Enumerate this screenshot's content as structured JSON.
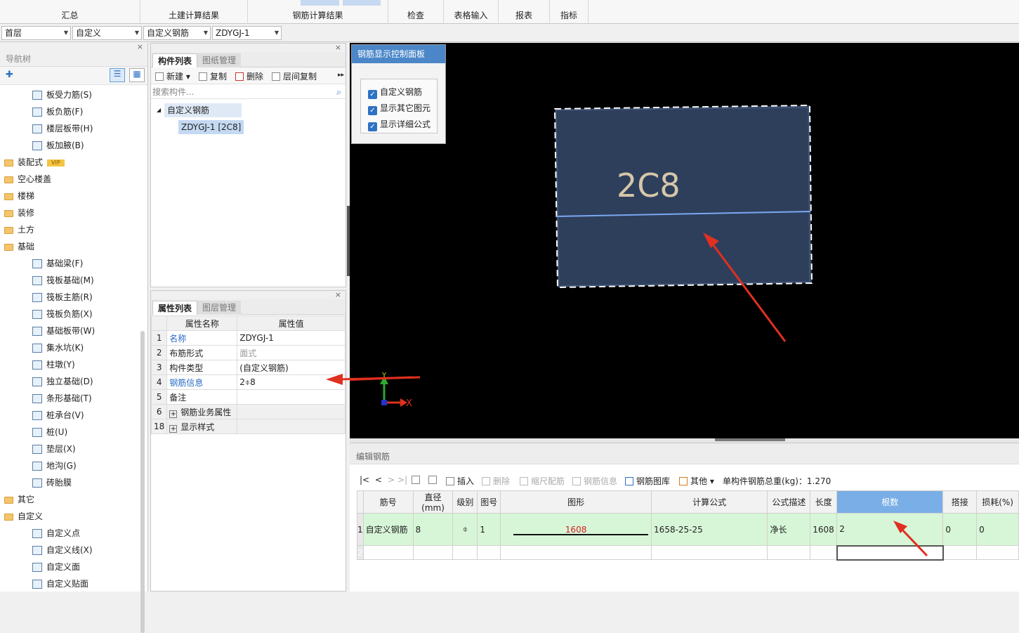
{
  "menu": [
    "汇总",
    "土建计算结果",
    "钢筋计算结果",
    "检查",
    "表格输入",
    "报表",
    "指标"
  ],
  "selectors": [
    "首层",
    "自定义",
    "自定义钢筋",
    "ZDYGJ-1"
  ],
  "nav": {
    "title": "导航树",
    "items": [
      {
        "label": "板受力筋(S)",
        "level": 2
      },
      {
        "label": "板负筋(F)",
        "level": 2
      },
      {
        "label": "楼层板带(H)",
        "level": 2
      },
      {
        "label": "板加腋(B)",
        "level": 2
      },
      {
        "label": "装配式",
        "level": 1,
        "vip": "VIP"
      },
      {
        "label": "空心楼盖",
        "level": 1
      },
      {
        "label": "楼梯",
        "level": 1
      },
      {
        "label": "装修",
        "level": 1
      },
      {
        "label": "土方",
        "level": 1
      },
      {
        "label": "基础",
        "level": 1,
        "open": true
      },
      {
        "label": "基础梁(F)",
        "level": 2
      },
      {
        "label": "筏板基础(M)",
        "level": 2
      },
      {
        "label": "筏板主筋(R)",
        "level": 2
      },
      {
        "label": "筏板负筋(X)",
        "level": 2
      },
      {
        "label": "基础板带(W)",
        "level": 2
      },
      {
        "label": "集水坑(K)",
        "level": 2
      },
      {
        "label": "柱墩(Y)",
        "level": 2
      },
      {
        "label": "独立基础(D)",
        "level": 2
      },
      {
        "label": "条形基础(T)",
        "level": 2
      },
      {
        "label": "桩承台(V)",
        "level": 2
      },
      {
        "label": "桩(U)",
        "level": 2
      },
      {
        "label": "垫层(X)",
        "level": 2
      },
      {
        "label": "地沟(G)",
        "level": 2
      },
      {
        "label": "砖胎膜",
        "level": 2
      },
      {
        "label": "其它",
        "level": 1
      },
      {
        "label": "自定义",
        "level": 1,
        "open": true
      },
      {
        "label": "自定义点",
        "level": 2
      },
      {
        "label": "自定义线(X)",
        "level": 2
      },
      {
        "label": "自定义面",
        "level": 2
      },
      {
        "label": "自定义贴面",
        "level": 2
      }
    ]
  },
  "complist": {
    "tab_active": "构件列表",
    "tab_inactive": "图纸管理",
    "tools": [
      "新建",
      "复制",
      "删除",
      "层间复制"
    ],
    "search_placeholder": "搜索构件...",
    "tree_parent": "自定义钢筋",
    "tree_child": "ZDYGJ-1 [2C8]"
  },
  "props": {
    "tab_active": "属性列表",
    "tab_inactive": "图层管理",
    "col_name": "属性名称",
    "col_value": "属性值",
    "rows": [
      {
        "no": "1",
        "name": "名称",
        "value": "ZDYGJ-1",
        "style": "blue"
      },
      {
        "no": "2",
        "name": "布筋形式",
        "value": "面式",
        "style": "grey-val"
      },
      {
        "no": "3",
        "name": "构件类型",
        "value": "(自定义钢筋)",
        "style": ""
      },
      {
        "no": "4",
        "name": "钢筋信息",
        "value": "2⌽8",
        "style": "blue"
      },
      {
        "no": "5",
        "name": "备注",
        "value": "",
        "style": ""
      },
      {
        "no": "6",
        "name": "钢筋业务属性",
        "value": "",
        "style": "plus"
      },
      {
        "no": "18",
        "name": "显示样式",
        "value": "",
        "style": "plus"
      }
    ]
  },
  "ctrl_panel": {
    "title": "钢筋显示控制面板",
    "options": [
      "自定义钢筋",
      "显示其它图元",
      "显示详细公式"
    ]
  },
  "canvas": {
    "label": "2C8",
    "axis_x": "X",
    "axis_y": "Y"
  },
  "edit": {
    "title": "编辑钢筋",
    "nav": [
      "|<",
      "<",
      ">",
      ">|"
    ],
    "tools": [
      {
        "label": "插入",
        "disabled": false
      },
      {
        "label": "删除",
        "disabled": true
      },
      {
        "label": "缩尺配筋",
        "disabled": true
      },
      {
        "label": "钢筋信息",
        "disabled": true
      },
      {
        "label": "钢筋图库",
        "disabled": false
      },
      {
        "label": "其他",
        "disabled": false
      }
    ],
    "total": "单构件钢筋总重(kg)：1.270",
    "headers": [
      "筋号",
      "直径(mm)",
      "级别",
      "图号",
      "图形",
      "计算公式",
      "公式描述",
      "长度",
      "根数",
      "搭接",
      "损耗(%)"
    ],
    "rows": [
      {
        "no": "1",
        "name": "自定义钢筋",
        "dia": "8",
        "grade": "⌽",
        "fig": "1",
        "shape": "1608",
        "formula": "1658-25-25",
        "desc": "净长",
        "length": "1608",
        "count": "2",
        "lap": "0",
        "loss": "0"
      },
      {
        "no": "2",
        "name": "",
        "dia": "",
        "grade": "",
        "fig": "",
        "shape": "",
        "formula": "",
        "desc": "",
        "length": "",
        "count": "",
        "lap": "",
        "loss": ""
      }
    ]
  }
}
